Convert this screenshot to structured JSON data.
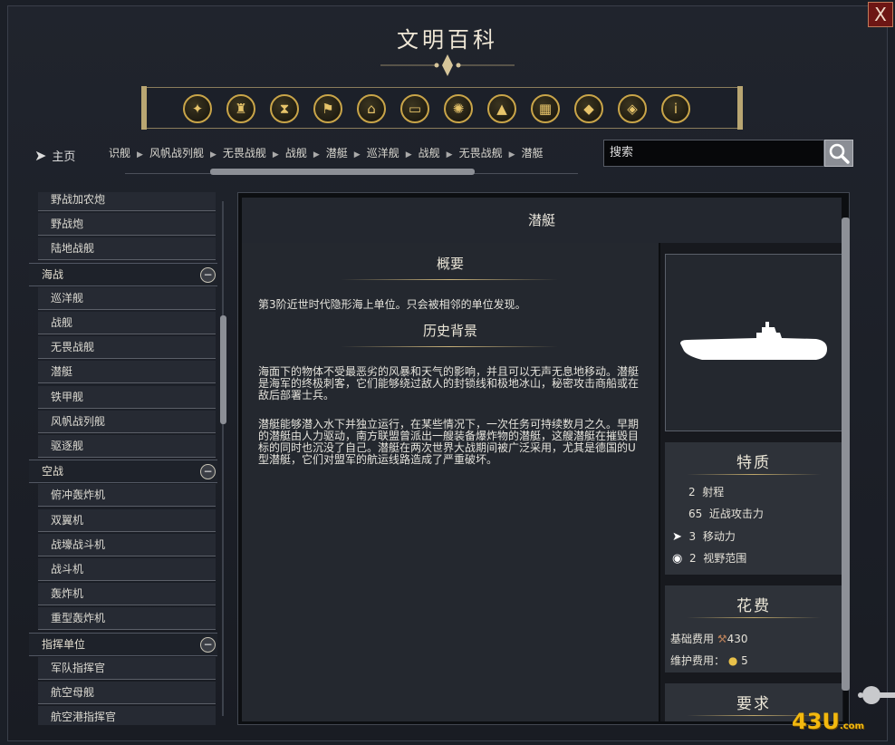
{
  "window": {
    "title": "文明百科",
    "close_label": "X"
  },
  "categories": [
    {
      "icon": "handshake-icon",
      "glyph": "✦"
    },
    {
      "icon": "goblet-icon",
      "glyph": "♜"
    },
    {
      "icon": "hourglass-icon",
      "glyph": "⧗"
    },
    {
      "icon": "flag-icon",
      "glyph": "⚑"
    },
    {
      "icon": "temple-icon",
      "glyph": "⌂"
    },
    {
      "icon": "book-icon",
      "glyph": "▭"
    },
    {
      "icon": "religion-icon",
      "glyph": "✺"
    },
    {
      "icon": "mountain-icon",
      "glyph": "▲"
    },
    {
      "icon": "building-icon",
      "glyph": "▦"
    },
    {
      "icon": "upgrade-icon",
      "glyph": "◆"
    },
    {
      "icon": "resource-icon",
      "glyph": "◈"
    },
    {
      "icon": "info-icon",
      "glyph": "i"
    }
  ],
  "nav": {
    "home_label": "主页",
    "breadcrumbs": [
      "识舰",
      "风帆战列舰",
      "无畏战舰",
      "战舰",
      "潜艇",
      "巡洋舰",
      "战舰",
      "无畏战舰",
      "潜艇"
    ],
    "search_placeholder": "搜索"
  },
  "sidebar": {
    "items": [
      {
        "type": "item",
        "label": "野战加农炮"
      },
      {
        "type": "item",
        "label": "野战炮"
      },
      {
        "type": "item",
        "label": "陆地战舰"
      },
      {
        "type": "header",
        "label": "海战"
      },
      {
        "type": "item",
        "label": "巡洋舰"
      },
      {
        "type": "item",
        "label": "战舰"
      },
      {
        "type": "item",
        "label": "无畏战舰"
      },
      {
        "type": "item",
        "label": "潜艇"
      },
      {
        "type": "item",
        "label": "铁甲舰"
      },
      {
        "type": "item",
        "label": "风帆战列舰"
      },
      {
        "type": "item",
        "label": "驱逐舰"
      },
      {
        "type": "header",
        "label": "空战"
      },
      {
        "type": "item",
        "label": "俯冲轰炸机"
      },
      {
        "type": "item",
        "label": "双翼机"
      },
      {
        "type": "item",
        "label": "战壕战斗机"
      },
      {
        "type": "item",
        "label": "战斗机"
      },
      {
        "type": "item",
        "label": "轰炸机"
      },
      {
        "type": "item",
        "label": "重型轰炸机"
      },
      {
        "type": "header",
        "label": "指挥单位"
      },
      {
        "type": "item",
        "label": "军队指挥官"
      },
      {
        "type": "item",
        "label": "航空母舰"
      },
      {
        "type": "item",
        "label": "航空港指挥官"
      }
    ]
  },
  "article": {
    "title": "潜艇",
    "summary_heading": "概要",
    "summary_text": "第3阶近世时代隐形海上单位。只会被相邻的单位发现。",
    "history_heading": "历史背景",
    "history_p1": "海面下的物体不受最恶劣的风暴和天气的影响，并且可以无声无息地移动。潜艇是海军的终极刺客，它们能够绕过敌人的封锁线和极地冰山，秘密攻击商船或在敌后部署士兵。",
    "history_p2": "潜艇能够潜入水下并独立运行，在某些情况下，一次任务可持续数月之久。早期的潜艇由人力驱动，南方联盟曾派出一艘装备爆炸物的潜艇，这艘潜艇在摧毁目标的同时也沉没了自己。潜艇在两次世界大战期间被广泛采用，尤其是德国的U型潜艇，它们对盟军的航运线路造成了严重破坏。"
  },
  "traits": {
    "heading": "特质",
    "range": {
      "value": "2",
      "label": "射程"
    },
    "melee": {
      "value": "65",
      "label": "近战攻击力"
    },
    "movement": {
      "value": "3",
      "label": "移动力"
    },
    "sight": {
      "value": "2",
      "label": "视野范围"
    }
  },
  "cost": {
    "heading": "花费",
    "base_label": "基础费用",
    "base_value": "430",
    "upkeep_label": "维护费用：",
    "upkeep_value": "5"
  },
  "requirements": {
    "heading": "要求"
  },
  "watermark": {
    "text": "43U",
    "suffix": ".com"
  }
}
